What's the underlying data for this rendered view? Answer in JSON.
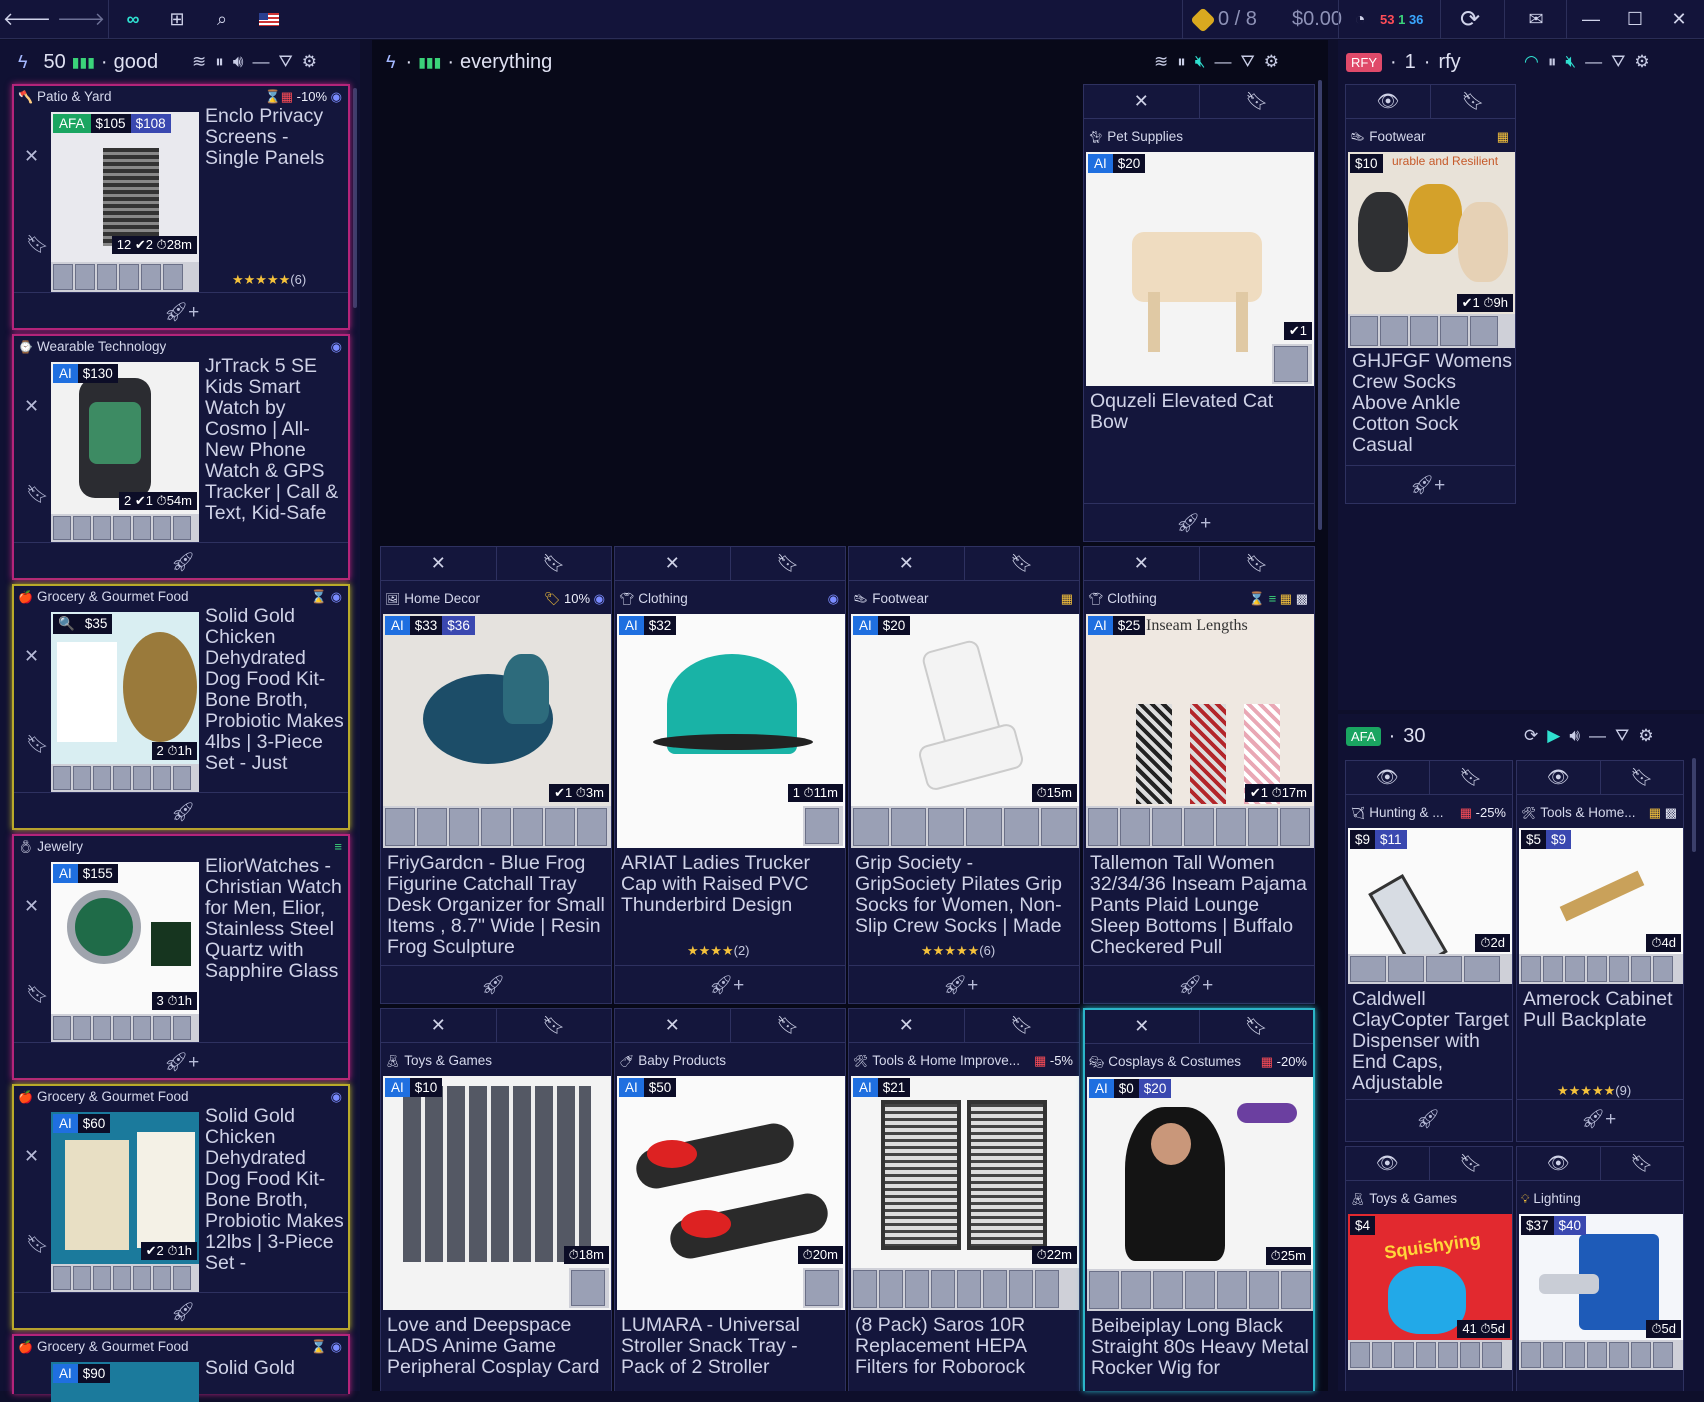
{
  "topbar": {
    "back_icon": "back-arrow-icon",
    "forward_icon": "forward-arrow-icon",
    "coins": "0 / 8",
    "balance": "$0.00",
    "stats": [
      "53",
      "1",
      "36"
    ],
    "stat_colors": [
      "#ff4d57",
      "#3bd37a",
      "#3aa7ff"
    ]
  },
  "panels": {
    "left": {
      "count": "50",
      "name": "good"
    },
    "center": {
      "name": "everything"
    },
    "right_top": {
      "badge": "RFY",
      "count": "1",
      "name": "rfy"
    },
    "right_bottom": {
      "badge": "AFA",
      "count": "30"
    }
  },
  "left_cards": [
    {
      "category": "Patio & Yard",
      "discount": "-10%",
      "tag": "AFA",
      "price": "$105",
      "price_alt": "$108",
      "meta": "12 ✔2 ⏱28m",
      "title": "Enclo Privacy Screens - Single Panels",
      "stars": "★★★★★",
      "reviews": "(6)"
    },
    {
      "category": "Wearable Technology",
      "tag": "AI",
      "price": "$130",
      "meta": "2 ✔1 ⏱54m",
      "title": "JrTrack 5 SE Kids Smart Watch by Cosmo | All-New Phone Watch & GPS Tracker | Call & Text, Kid-Safe"
    },
    {
      "category": "Grocery & Gourmet Food",
      "tag": "🔍",
      "price": "$35",
      "meta": "2 ⏱1h",
      "title": "Solid Gold Chicken Dehydrated Dog Food Kit- Bone Broth, Probiotic Makes 4lbs | 3-Piece Set - Just"
    },
    {
      "category": "Jewelry",
      "tag": "AI",
      "price": "$155",
      "meta": "3 ⏱1h",
      "title": "EliorWatches - Christian Watch for Men, Elior, Stainless Steel Quartz with Sapphire Glass"
    },
    {
      "category": "Grocery & Gourmet Food",
      "tag": "AI",
      "price": "$60",
      "meta": "✔2 ⏱1h",
      "title": "Solid Gold Chicken Dehydrated Dog Food Kit- Bone Broth, Probiotic Makes 12lbs | 3-Piece Set -"
    },
    {
      "category": "Grocery & Gourmet Food",
      "tag": "AI",
      "price": "$90",
      "title": "Solid Gold"
    }
  ],
  "center_cards": [
    {
      "category": "Pet Supplies",
      "tag": "AI",
      "price": "$20",
      "meta": "✔1",
      "title": "Oquzeli Elevated Cat Bow"
    },
    {
      "category": "Home Decor",
      "discount": "10%",
      "tag": "AI",
      "price": "$33",
      "price_alt": "$36",
      "meta": "✔1 ⏱3m",
      "title": "FriyGardcn - Blue Frog Figurine Catchall Tray Desk Organizer for Small Items , 8.7\" Wide | Resin Frog Sculpture"
    },
    {
      "category": "Clothing",
      "tag": "AI",
      "price": "$32",
      "meta": "1 ⏱11m",
      "title": "ARIAT Ladies Trucker Cap with Raised PVC Thunderbird Design",
      "stars": "★★★★",
      "reviews": "(2)"
    },
    {
      "category": "Footwear",
      "tag": "AI",
      "price": "$20",
      "meta": "⏱15m",
      "title": "Grip Society - GripSociety Pilates Grip Socks for Women, Non-Slip Crew Socks | Made",
      "stars": "★★★★★",
      "reviews": "(6)"
    },
    {
      "category": "Clothing",
      "tag": "AI",
      "price": "$25",
      "meta": "✔1 ⏱17m",
      "title": "Tallemon Tall Women 32/34/36 Inseam Pajama Pants Plaid Lounge Sleep Bottoms | Buffalo Checkered Pull",
      "img_text": "Inseam Lengths"
    },
    {
      "category": "Toys & Games",
      "tag": "AI",
      "price": "$10",
      "meta": "⏱18m",
      "title": "Love and Deepspace LADS Anime Game Peripheral Cosplay Card"
    },
    {
      "category": "Baby Products",
      "tag": "AI",
      "price": "$50",
      "meta": "⏱20m",
      "title": "LUMARA - Universal Stroller Snack Tray - Pack of 2 Stroller"
    },
    {
      "category": "Tools & Home Improve...",
      "discount": "-5%",
      "tag": "AI",
      "price": "$21",
      "meta": "⏱22m",
      "title": "(8 Pack) Saros 10R Replacement HEPA Filters for Roborock"
    },
    {
      "category": "Cosplays & Costumes",
      "discount": "-20%",
      "tag": "AI",
      "price": "$0",
      "price_alt": "$20",
      "meta": "⏱25m",
      "title": "Beibeiplay Long Black Straight 80s Heavy Metal Rocker Wig for"
    }
  ],
  "right_top_card": {
    "category": "Footwear",
    "price": "$10",
    "meta": "✔1 ⏱9h",
    "img_text": "urable and Resilient",
    "title": "GHJFGF Womens Crew Socks Above Ankle Cotton Sock Casual"
  },
  "right_cards": [
    {
      "category": "Hunting & ...",
      "discount": "-25%",
      "price": "$9",
      "price_alt": "$11",
      "meta": "⏱2d",
      "title": "Caldwell ClayCopter Target Dispenser with End Caps, Adjustable"
    },
    {
      "category": "Tools & Home...",
      "price": "$5",
      "price_alt": "$9",
      "meta": "⏱4d",
      "title": "Amerock Cabinet Pull Backplate",
      "stars": "★★★★★",
      "reviews": "(9)"
    },
    {
      "category": "Toys & Games",
      "price": "$4",
      "meta": "41 ⏱5d",
      "img_text": "Squishying",
      "title": ""
    },
    {
      "category": "Lighting",
      "price": "$37",
      "price_alt": "$40",
      "meta": "⏱5d",
      "title": ""
    }
  ]
}
